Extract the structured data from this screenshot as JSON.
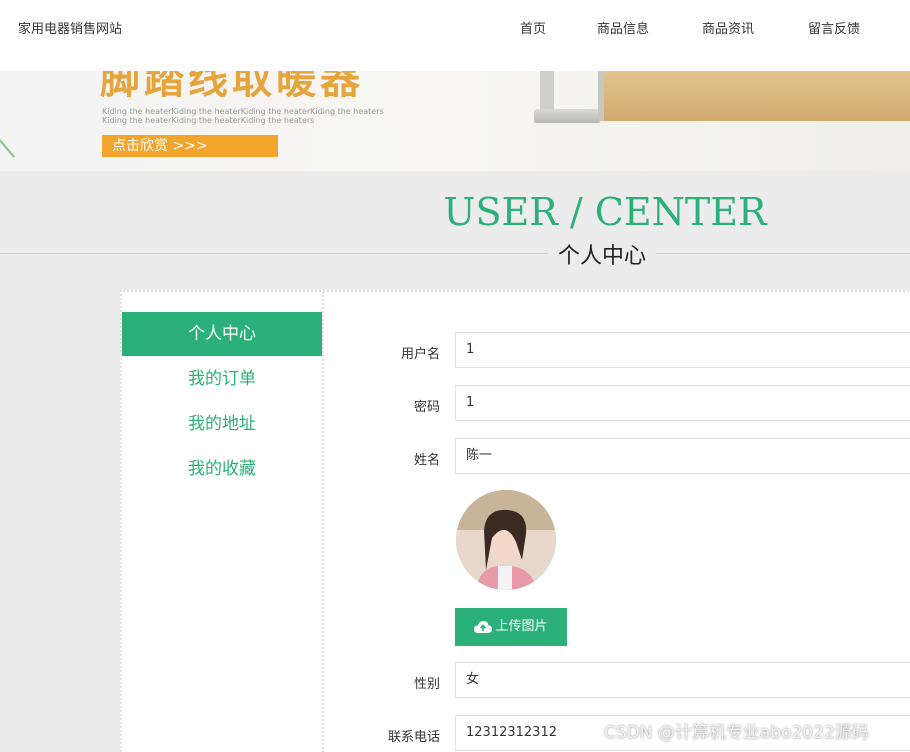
{
  "header": {
    "site_title": "家用电器销售网站",
    "nav": [
      "首页",
      "商品信息",
      "商品资讯",
      "留言反馈"
    ]
  },
  "banner": {
    "headline": "脚踏线取暖器",
    "sub_line1": "Kiding the heaterKiding the heaterKiding the heaterKiding the heaters",
    "sub_line2": "Kiding the heaterKiding the heaterKiding the heaters",
    "cta": "点击欣赏 >>>"
  },
  "section": {
    "title_en": "USER / CENTER",
    "title_cn": "个人中心"
  },
  "sidebar": {
    "items": [
      "个人中心",
      "我的订单",
      "我的地址",
      "我的收藏"
    ],
    "active_index": 0
  },
  "form": {
    "username": {
      "label": "用户名",
      "value": "1"
    },
    "password": {
      "label": "密码",
      "value": "1"
    },
    "name": {
      "label": "姓名",
      "value": "陈一"
    },
    "upload_label": "上传图片",
    "gender": {
      "label": "性别",
      "value": "女"
    },
    "phone": {
      "label": "联系电话",
      "value": "12312312312"
    }
  },
  "watermark": "CSDN @计算机专业abo2022源码",
  "colors": {
    "accent": "#2cb07a",
    "banner_orange": "#f2a52a"
  }
}
